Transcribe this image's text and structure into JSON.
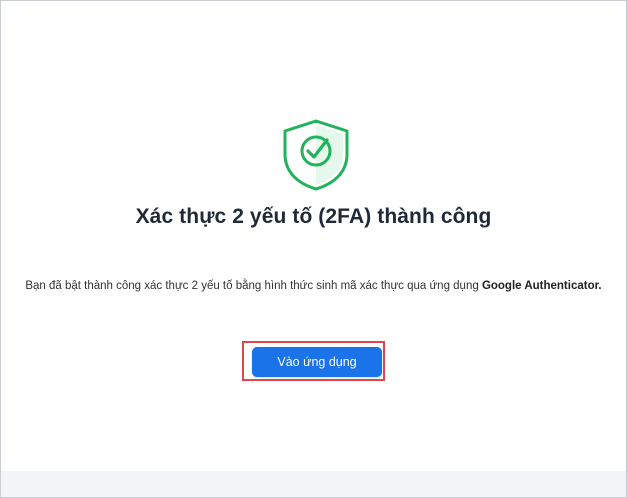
{
  "success": {
    "title": "Xác thực 2 yếu tố (2FA) thành công",
    "description_prefix": "Bạn đã bật thành công xác thực 2 yếu tố bằng hình thức sinh mã xác thực qua ứng dụng ",
    "description_app": "Google Authenticator.",
    "icon": "shield-check-icon"
  },
  "actions": {
    "open_app_label": "Vào ứng dụng"
  },
  "colors": {
    "primary": "#1a73e8",
    "success": "#21b35c",
    "success_light": "#e6f7ec",
    "highlight": "#e0474c"
  }
}
